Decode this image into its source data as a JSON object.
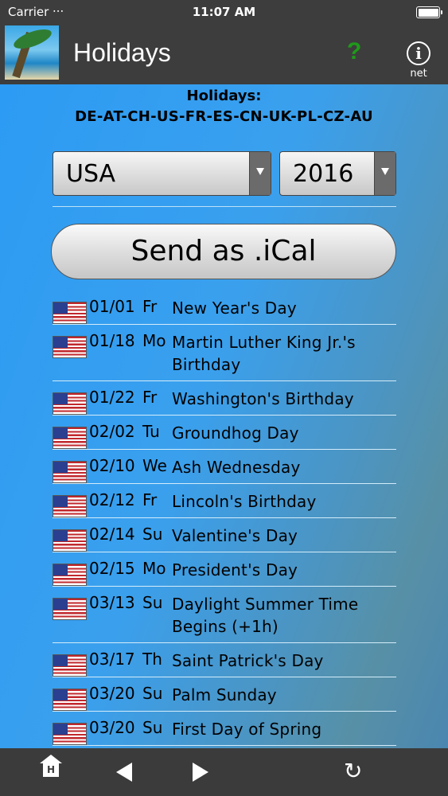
{
  "status_bar": {
    "carrier": "Carrier",
    "time": "11:07 AM"
  },
  "nav": {
    "title": "Holidays",
    "help_label": "?",
    "info_glyph": "i",
    "info_label": "net"
  },
  "header": {
    "line1": "Holidays:",
    "line2": "DE-AT-CH-US-FR-ES-CN-UK-PL-CZ-AU"
  },
  "country_select": {
    "value": "USA"
  },
  "year_select": {
    "value": "2016"
  },
  "ical_button": {
    "label": "Send as .iCal"
  },
  "holidays": [
    {
      "date": "01/01",
      "dow": "Fr",
      "name": "New Year's Day"
    },
    {
      "date": "01/18",
      "dow": "Mo",
      "name": "Martin Luther King Jr.'s Birthday"
    },
    {
      "date": "01/22",
      "dow": "Fr",
      "name": "Washington's Birthday"
    },
    {
      "date": "02/02",
      "dow": "Tu",
      "name": "Groundhog Day"
    },
    {
      "date": "02/10",
      "dow": "We",
      "name": "Ash Wednesday"
    },
    {
      "date": "02/12",
      "dow": "Fr",
      "name": "Lincoln's Birthday"
    },
    {
      "date": "02/14",
      "dow": "Su",
      "name": "Valentine's Day"
    },
    {
      "date": "02/15",
      "dow": "Mo",
      "name": "President's Day"
    },
    {
      "date": "03/13",
      "dow": "Su",
      "name": "Daylight Summer Time Begins (+1h)"
    },
    {
      "date": "03/17",
      "dow": "Th",
      "name": "Saint Patrick's Day"
    },
    {
      "date": "03/20",
      "dow": "Su",
      "name": "Palm Sunday"
    },
    {
      "date": "03/20",
      "dow": "Su",
      "name": "First Day of Spring"
    }
  ],
  "icons": {
    "app": "beach-palm-icon",
    "help": "question-mark-icon",
    "info": "info-circle-icon",
    "flag": "us-flag-icon",
    "home": "home-icon",
    "back": "back-arrow-icon",
    "forward": "forward-arrow-icon",
    "reload": "reload-icon"
  },
  "colors": {
    "content_bg": "#2c9bf3",
    "bar_bg": "#3d3d3d",
    "help": "#1f9a1a"
  }
}
